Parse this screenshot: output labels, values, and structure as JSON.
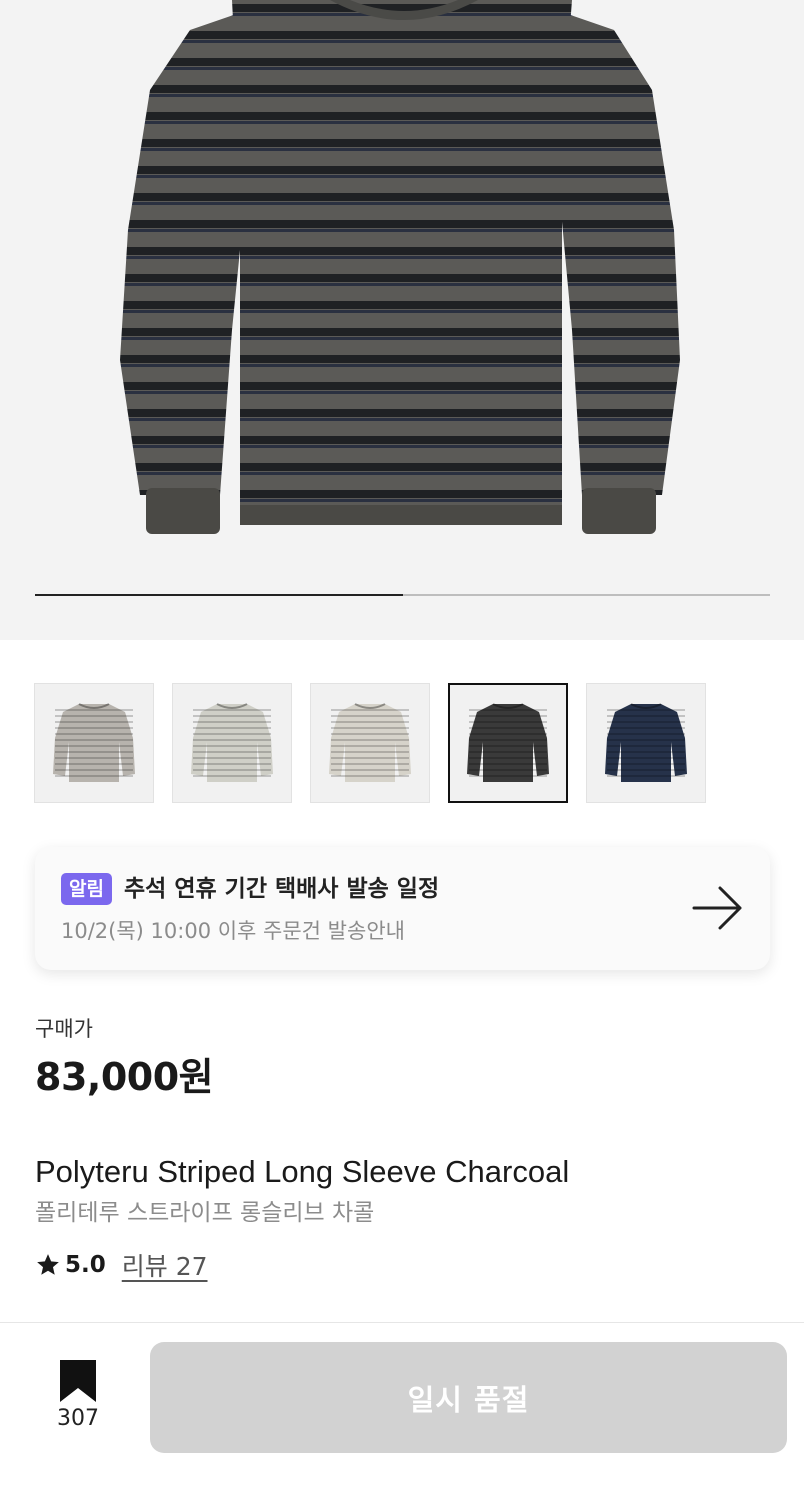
{
  "gallery": {
    "current_slide": 1,
    "total_slides": 2,
    "progress_fraction": 0.5,
    "thumbnails": [
      {
        "color_name": "grey-stripe",
        "color": "#b7b3ad"
      },
      {
        "color_name": "light-grey-stripe",
        "color": "#cfcfc7"
      },
      {
        "color_name": "ivory-stripe",
        "color": "#d6d3ca"
      },
      {
        "color_name": "charcoal-stripe",
        "color": "#3a3a3a",
        "selected": true
      },
      {
        "color_name": "navy-stripe",
        "color": "#26324a"
      }
    ]
  },
  "notice": {
    "badge": "알림",
    "title": "추석 연휴 기간 택배사 발송 일정",
    "subtitle": "10/2(목) 10:00 이후 주문건 발송안내",
    "badge_color": "#7b68ee"
  },
  "price": {
    "label": "구매가",
    "value": "83,000원"
  },
  "product": {
    "name_en": "Polyteru Striped Long Sleeve Charcoal",
    "name_ko": "폴리테루 스트라이프 롱슬리브 차콜"
  },
  "rating": {
    "score": "5.0",
    "review_label": "리뷰 27"
  },
  "bottom_bar": {
    "bookmark_count": "307",
    "action_label": "일시 품절"
  }
}
